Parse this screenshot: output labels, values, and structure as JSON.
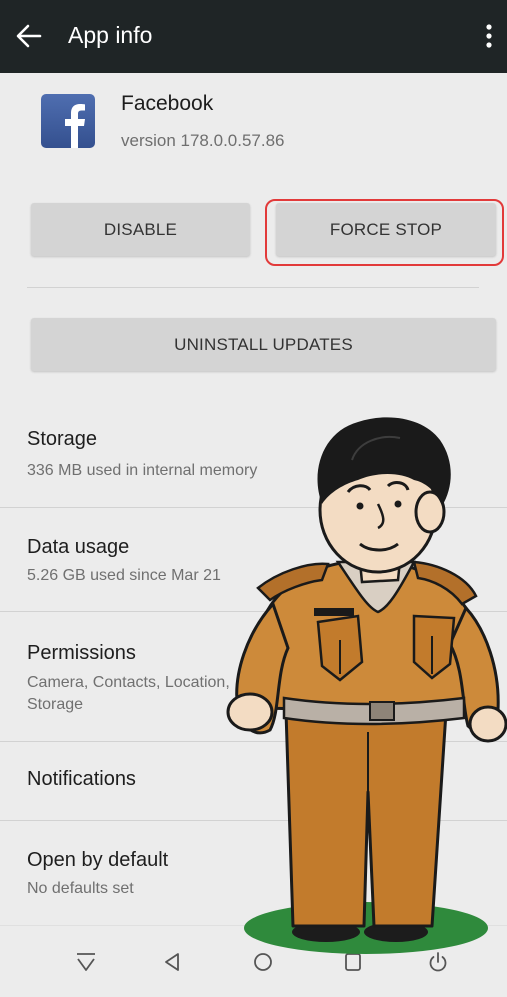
{
  "appbar": {
    "title": "App info"
  },
  "app": {
    "name": "Facebook",
    "version": "version 178.0.0.57.86"
  },
  "buttons": {
    "disable": "DISABLE",
    "force_stop": "FORCE STOP",
    "uninstall_updates": "UNINSTALL UPDATES"
  },
  "rows": {
    "storage": {
      "title": "Storage",
      "subtitle": "336 MB used in internal memory"
    },
    "data_usage": {
      "title": "Data usage",
      "subtitle": "5.26 GB used since Mar 21"
    },
    "permissions": {
      "title": "Permissions",
      "subtitle_line1": "Camera, Contacts, Location,",
      "subtitle_line2": "Storage"
    },
    "notifications": {
      "title": "Notifications"
    },
    "open_by_default": {
      "title": "Open by default",
      "subtitle": "No defaults set"
    }
  },
  "colors": {
    "appbar": "#1f2526",
    "highlight": "#e23a3a",
    "facebook_blue": "#3b5998"
  },
  "icons": [
    "back-arrow-icon",
    "more-vert-icon",
    "facebook-logo-icon",
    "nav-down-icon",
    "nav-back-icon",
    "nav-home-icon",
    "nav-recents-icon",
    "nav-power-icon"
  ]
}
